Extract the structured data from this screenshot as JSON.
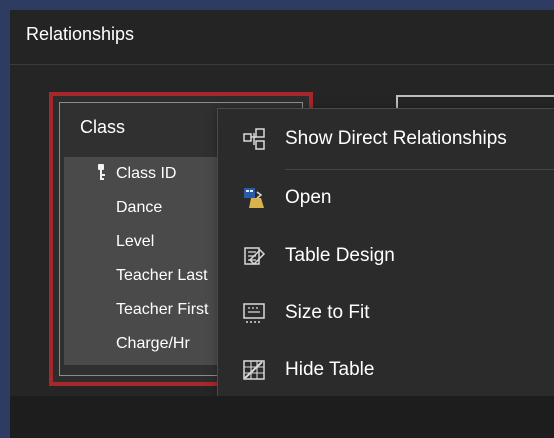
{
  "window": {
    "title": "Relationships"
  },
  "table": {
    "name": "Class",
    "fields": [
      "Class ID",
      "Dance",
      "Level",
      "Teacher Last",
      "Teacher First",
      "Charge/Hr"
    ]
  },
  "context_menu": {
    "items": [
      {
        "label": "Show Direct Relationships",
        "icon": "show-direct-relationships-icon"
      },
      {
        "label": "Open",
        "icon": "open-icon"
      },
      {
        "label": "Table Design",
        "icon": "table-design-icon"
      },
      {
        "label": "Size to Fit",
        "icon": "size-to-fit-icon"
      },
      {
        "label": "Hide Table",
        "icon": "hide-table-icon"
      }
    ]
  },
  "colors": {
    "background": "#2f3c62",
    "panel": "#2b2b2b",
    "selected_border": "#a6272c",
    "field_highlight": "#4a4a4a"
  }
}
